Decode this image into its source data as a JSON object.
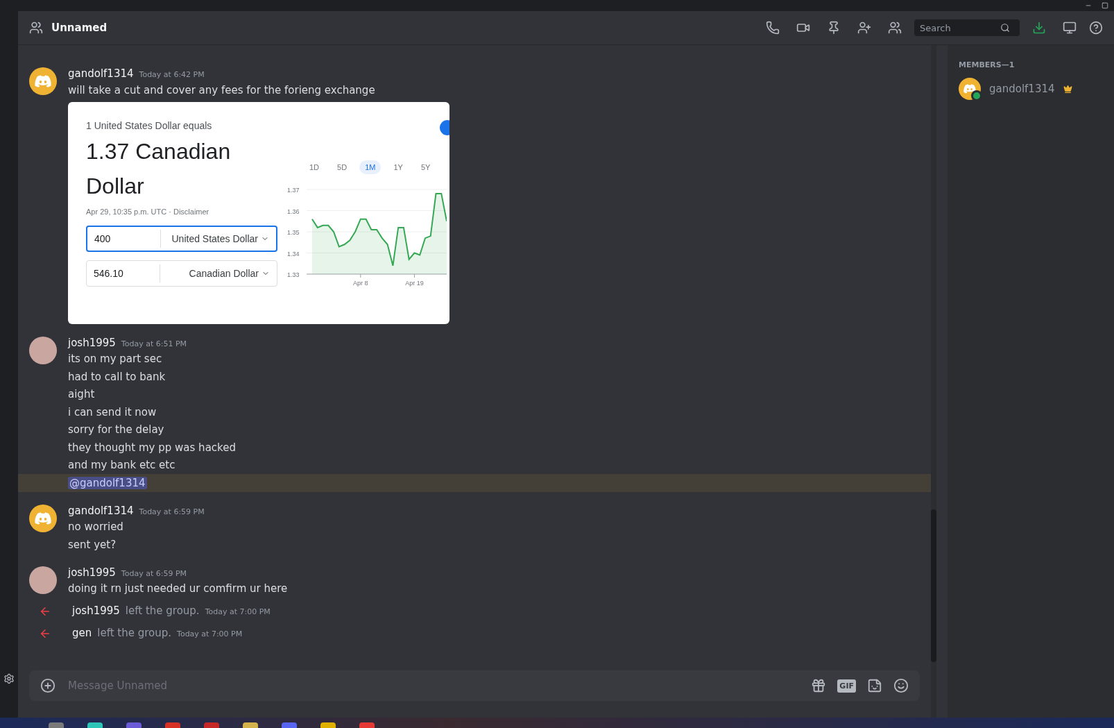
{
  "header": {
    "title": "Unnamed",
    "search": {
      "placeholder": "Search"
    }
  },
  "messages": [
    {
      "kind": "message",
      "author": "gandolf1314",
      "avatar": {
        "kind": "logo"
      },
      "time": "Today at 6:42 PM",
      "lines": [
        {
          "text": "will take a cut and cover any fees for the forieng exchange",
          "kind": "text"
        }
      ],
      "embed": {
        "subtitle": "1 United States Dollar equals",
        "headline": "1.37 Canadian Dollar",
        "meta": "Apr 29, 10:35 p.m. UTC · Disclaimer",
        "rows": [
          {
            "value": "400",
            "currency": "United States Dollar",
            "focused": true
          },
          {
            "value": "546.10",
            "currency": "Canadian Dollar",
            "focused": false
          }
        ],
        "ranges": [
          {
            "label": "1D",
            "selected": false
          },
          {
            "label": "5D",
            "selected": false
          },
          {
            "label": "1M",
            "selected": true
          },
          {
            "label": "1Y",
            "selected": false
          },
          {
            "label": "5Y",
            "selected": false
          }
        ],
        "chart_data": {
          "type": "area",
          "categories": [
            null,
            null,
            null,
            null,
            null,
            null,
            null,
            null,
            null,
            "Apr 8",
            null,
            null,
            null,
            null,
            null,
            null,
            null,
            null,
            null,
            "Apr 19",
            null,
            null,
            null,
            null,
            null,
            null
          ],
          "series": [
            {
              "color": "#34a853",
              "values": [
                1.356,
                1.352,
                1.353,
                1.353,
                1.35,
                1.343,
                1.344,
                1.346,
                1.35,
                1.356,
                1.356,
                1.351,
                1.351,
                1.347,
                1.344,
                1.334,
                1.352,
                1.352,
                1.337,
                1.34,
                1.339,
                1.347,
                1.348,
                1.368,
                1.368,
                1.355
              ]
            }
          ],
          "grid": true,
          "ylim": [
            1.33,
            1.37
          ],
          "yticks": [
            1.33,
            1.34,
            1.35,
            1.36,
            1.37
          ]
        }
      }
    },
    {
      "kind": "message",
      "author": "josh1995",
      "avatar": {
        "kind": "photo"
      },
      "time": "Today at 6:51 PM",
      "lines": [
        {
          "text": "its on my part sec",
          "kind": "text"
        },
        {
          "text": "had to call to bank",
          "kind": "text"
        },
        {
          "text": "aight",
          "kind": "text"
        },
        {
          "text": "i can send it now",
          "kind": "text"
        },
        {
          "text": "sorry for the delay",
          "kind": "text"
        },
        {
          "text": "they thought my pp was hacked",
          "kind": "text"
        },
        {
          "text": "and my bank etc etc",
          "kind": "text"
        },
        {
          "text": "@gandolf1314",
          "kind": "mention"
        }
      ]
    },
    {
      "kind": "message",
      "author": "gandolf1314",
      "avatar": {
        "kind": "logo"
      },
      "time": "Today at 6:59 PM",
      "lines": [
        {
          "text": "no worried",
          "kind": "text"
        },
        {
          "text": "sent yet?",
          "kind": "text"
        }
      ]
    },
    {
      "kind": "message",
      "author": "josh1995",
      "avatar": {
        "kind": "photo"
      },
      "time": "Today at 6:59 PM",
      "lines": [
        {
          "text": "doing it rn just needed ur comfirm ur here",
          "kind": "text"
        }
      ]
    },
    {
      "kind": "leave",
      "author": "josh1995",
      "action": "left the group.",
      "time": "Today at 7:00 PM"
    },
    {
      "kind": "leave",
      "author": "gen",
      "action": "left the group.",
      "time": "Today at 7:00 PM"
    }
  ],
  "composer": {
    "placeholder": "Message Unnamed",
    "gif_label": "GIF"
  },
  "members": {
    "heading": "MEMBERS—1",
    "items": [
      {
        "name": "gandolf1314",
        "owner": true,
        "online": true
      }
    ]
  }
}
